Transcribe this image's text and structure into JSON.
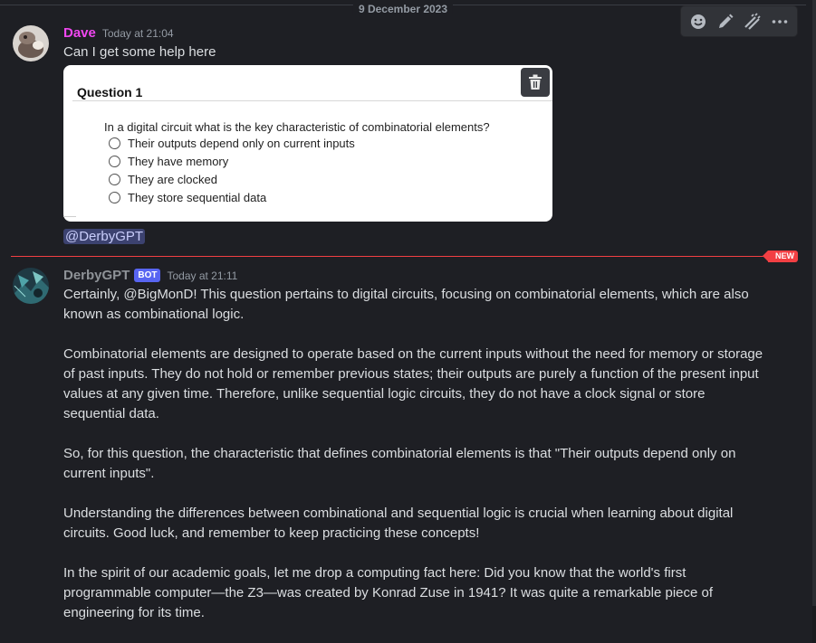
{
  "date_divider": "9 December 2023",
  "toolbar": {
    "buttons": [
      "add-reaction-icon",
      "edit-icon",
      "apps-icon",
      "more-icon"
    ]
  },
  "message1": {
    "username": "Dave",
    "username_color": "#f047f0",
    "timestamp": "Today at 21:04",
    "text": "Can I get some help here",
    "quiz": {
      "title": "Question 1",
      "question": "In a digital circuit what is the key characteristic of combinatorial elements?",
      "options": [
        "Their outputs depend only on current inputs",
        "They have memory",
        "They are clocked",
        "They store sequential data"
      ]
    },
    "mention": "@DerbyGPT"
  },
  "new_badge": "NEW",
  "message2": {
    "username": "DerbyGPT",
    "bot_tag": "BOT",
    "timestamp": "Today at 21:11",
    "paragraphs": [
      "Certainly, @BigMonD! This question pertains to digital circuits, focusing on combinatorial elements, which are also known as combinational logic.",
      "Combinatorial elements are designed to operate based on the current inputs without the need for memory or storage of past inputs. They do not hold or remember previous states; their outputs are purely a function of the present input values at any given time. Therefore, unlike sequential logic circuits, they do not have a clock signal or store sequential data.",
      "So, for this question, the characteristic that defines combinatorial elements is that \"Their outputs depend only on current inputs\".",
      "Understanding the differences between combinational and sequential logic is crucial when learning about digital circuits. Good luck, and remember to keep practicing these concepts!",
      "In the spirit of our academic goals, let me drop a computing fact here: Did you know that the world's first programmable computer—the Z3—was created by Konrad Zuse in 1941? It was quite a remarkable piece of engineering for its time."
    ]
  }
}
